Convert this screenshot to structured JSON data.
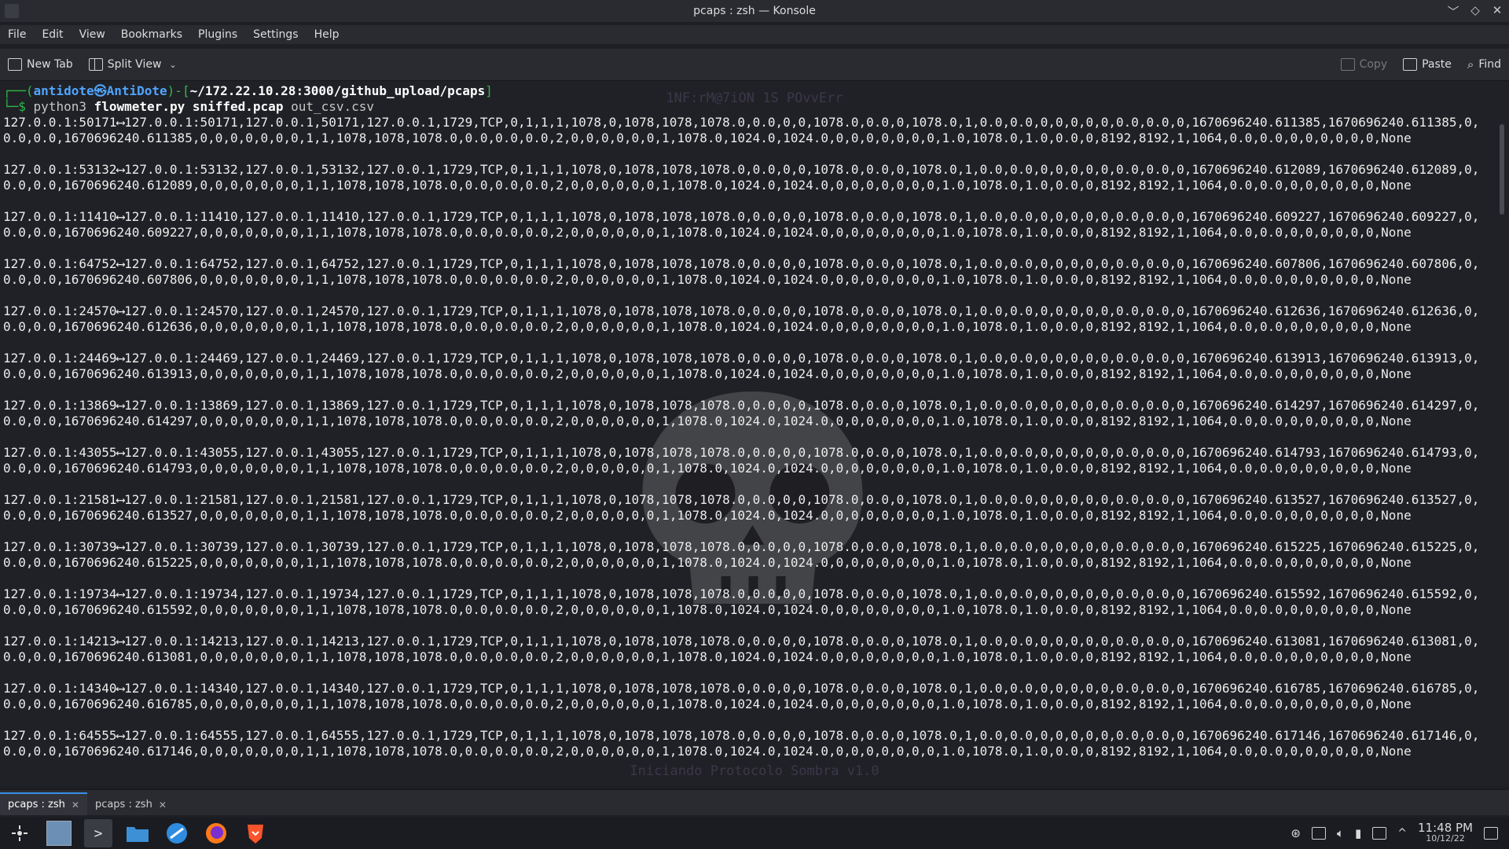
{
  "window": {
    "title": "pcaps : zsh — Konsole",
    "controls": [
      "﹀",
      "◇",
      "✕"
    ]
  },
  "menu": [
    "File",
    "Edit",
    "View",
    "Bookmarks",
    "Plugins",
    "Settings",
    "Help"
  ],
  "toolbar": {
    "new_tab": "New Tab",
    "split_view": "Split View",
    "copy": "Copy",
    "paste": "Paste",
    "find": "Find"
  },
  "terminal": {
    "prompt_line": "┌──(antidote㉿AntiDote)-[~/172.22.10.28:3000/github_upload/pcaps]",
    "prompt_user": "antidote㉿AntiDote",
    "prompt_path": "~/172.22.10.28:3000/github_upload/pcaps",
    "cmd_prefix": "└─$",
    "cmd_python": "python3",
    "cmd_script": "flowmeter.py sniffed.pcap",
    "cmd_out": "out_csv.csv",
    "rows": [
      [
        "127.0.0.1:50171⟷127.0.0.1:50171,127.0.0.1,50171,127.0.0.1,1729,TCP,0,1,1,1,1078,0,1078,1078,1078.0,0.0,0,0,1078.0,0.0,0,1078.0,1,0.0,0.0,0,0,0,0,0,0.0,0.0,0,1670696240.611385,1670696240.611385,0,",
        "0.0,0.0,1670696240.611385,0,0,0,0,0,0,0,1,1,1078,1078,1078.0,0.0,0.0,0.0,2,0,0,0,0,0,0,1,1078.0,1024.0,1024.0,0,0,0,0,0,0,0,1.0,1078.0,1.0,0.0,0,8192,8192,1,1064,0.0,0.0,0,0,0,0,0,0,None"
      ],
      [
        "127.0.0.1:53132⟷127.0.0.1:53132,127.0.0.1,53132,127.0.0.1,1729,TCP,0,1,1,1,1078,0,1078,1078,1078.0,0.0,0,0,1078.0,0.0,0,1078.0,1,0.0,0.0,0,0,0,0,0,0.0,0.0,0,1670696240.612089,1670696240.612089,0,",
        "0.0,0.0,1670696240.612089,0,0,0,0,0,0,0,1,1,1078,1078,1078.0,0.0,0.0,0.0,2,0,0,0,0,0,0,1,1078.0,1024.0,1024.0,0,0,0,0,0,0,0,1.0,1078.0,1.0,0.0,0,8192,8192,1,1064,0.0,0.0,0,0,0,0,0,0,None"
      ],
      [
        "127.0.0.1:11410⟷127.0.0.1:11410,127.0.0.1,11410,127.0.0.1,1729,TCP,0,1,1,1,1078,0,1078,1078,1078.0,0.0,0,0,1078.0,0.0,0,1078.0,1,0.0,0.0,0,0,0,0,0,0.0,0.0,0,1670696240.609227,1670696240.609227,0,",
        "0.0,0.0,1670696240.609227,0,0,0,0,0,0,0,1,1,1078,1078,1078.0,0.0,0.0,0.0,2,0,0,0,0,0,0,1,1078.0,1024.0,1024.0,0,0,0,0,0,0,0,1.0,1078.0,1.0,0.0,0,8192,8192,1,1064,0.0,0.0,0,0,0,0,0,0,None"
      ],
      [
        "127.0.0.1:64752⟷127.0.0.1:64752,127.0.0.1,64752,127.0.0.1,1729,TCP,0,1,1,1,1078,0,1078,1078,1078.0,0.0,0,0,1078.0,0.0,0,1078.0,1,0.0,0.0,0,0,0,0,0,0.0,0.0,0,1670696240.607806,1670696240.607806,0,",
        "0.0,0.0,1670696240.607806,0,0,0,0,0,0,0,1,1,1078,1078,1078.0,0.0,0.0,0.0,2,0,0,0,0,0,0,1,1078.0,1024.0,1024.0,0,0,0,0,0,0,0,1.0,1078.0,1.0,0.0,0,8192,8192,1,1064,0.0,0.0,0,0,0,0,0,0,None"
      ],
      [
        "127.0.0.1:24570⟷127.0.0.1:24570,127.0.0.1,24570,127.0.0.1,1729,TCP,0,1,1,1,1078,0,1078,1078,1078.0,0.0,0,0,1078.0,0.0,0,1078.0,1,0.0,0.0,0,0,0,0,0,0.0,0.0,0,1670696240.612636,1670696240.612636,0,",
        "0.0,0.0,1670696240.612636,0,0,0,0,0,0,0,1,1,1078,1078,1078.0,0.0,0.0,0.0,2,0,0,0,0,0,0,1,1078.0,1024.0,1024.0,0,0,0,0,0,0,0,1.0,1078.0,1.0,0.0,0,8192,8192,1,1064,0.0,0.0,0,0,0,0,0,0,None"
      ],
      [
        "127.0.0.1:24469⟷127.0.0.1:24469,127.0.0.1,24469,127.0.0.1,1729,TCP,0,1,1,1,1078,0,1078,1078,1078.0,0.0,0,0,1078.0,0.0,0,1078.0,1,0.0,0.0,0,0,0,0,0,0.0,0.0,0,1670696240.613913,1670696240.613913,0,",
        "0.0,0.0,1670696240.613913,0,0,0,0,0,0,0,1,1,1078,1078,1078.0,0.0,0.0,0.0,2,0,0,0,0,0,0,1,1078.0,1024.0,1024.0,0,0,0,0,0,0,0,1.0,1078.0,1.0,0.0,0,8192,8192,1,1064,0.0,0.0,0,0,0,0,0,0,None"
      ],
      [
        "127.0.0.1:13869⟷127.0.0.1:13869,127.0.0.1,13869,127.0.0.1,1729,TCP,0,1,1,1,1078,0,1078,1078,1078.0,0.0,0,0,1078.0,0.0,0,1078.0,1,0.0,0.0,0,0,0,0,0,0.0,0.0,0,1670696240.614297,1670696240.614297,0,",
        "0.0,0.0,1670696240.614297,0,0,0,0,0,0,0,1,1,1078,1078,1078.0,0.0,0.0,0.0,2,0,0,0,0,0,0,1,1078.0,1024.0,1024.0,0,0,0,0,0,0,0,1.0,1078.0,1.0,0.0,0,8192,8192,1,1064,0.0,0.0,0,0,0,0,0,0,None"
      ],
      [
        "127.0.0.1:43055⟷127.0.0.1:43055,127.0.0.1,43055,127.0.0.1,1729,TCP,0,1,1,1,1078,0,1078,1078,1078.0,0.0,0,0,1078.0,0.0,0,1078.0,1,0.0,0.0,0,0,0,0,0,0.0,0.0,0,1670696240.614793,1670696240.614793,0,",
        "0.0,0.0,1670696240.614793,0,0,0,0,0,0,0,1,1,1078,1078,1078.0,0.0,0.0,0.0,2,0,0,0,0,0,0,1,1078.0,1024.0,1024.0,0,0,0,0,0,0,0,1.0,1078.0,1.0,0.0,0,8192,8192,1,1064,0.0,0.0,0,0,0,0,0,0,None"
      ],
      [
        "127.0.0.1:21581⟷127.0.0.1:21581,127.0.0.1,21581,127.0.0.1,1729,TCP,0,1,1,1,1078,0,1078,1078,1078.0,0.0,0,0,1078.0,0.0,0,1078.0,1,0.0,0.0,0,0,0,0,0,0.0,0.0,0,1670696240.613527,1670696240.613527,0,",
        "0.0,0.0,1670696240.613527,0,0,0,0,0,0,0,1,1,1078,1078,1078.0,0.0,0.0,0.0,2,0,0,0,0,0,0,1,1078.0,1024.0,1024.0,0,0,0,0,0,0,0,1.0,1078.0,1.0,0.0,0,8192,8192,1,1064,0.0,0.0,0,0,0,0,0,0,None"
      ],
      [
        "127.0.0.1:30739⟷127.0.0.1:30739,127.0.0.1,30739,127.0.0.1,1729,TCP,0,1,1,1,1078,0,1078,1078,1078.0,0.0,0,0,1078.0,0.0,0,1078.0,1,0.0,0.0,0,0,0,0,0,0.0,0.0,0,1670696240.615225,1670696240.615225,0,",
        "0.0,0.0,1670696240.615225,0,0,0,0,0,0,0,1,1,1078,1078,1078.0,0.0,0.0,0.0,2,0,0,0,0,0,0,1,1078.0,1024.0,1024.0,0,0,0,0,0,0,0,1.0,1078.0,1.0,0.0,0,8192,8192,1,1064,0.0,0.0,0,0,0,0,0,0,None"
      ],
      [
        "127.0.0.1:19734⟷127.0.0.1:19734,127.0.0.1,19734,127.0.0.1,1729,TCP,0,1,1,1,1078,0,1078,1078,1078.0,0.0,0,0,1078.0,0.0,0,1078.0,1,0.0,0.0,0,0,0,0,0,0.0,0.0,0,1670696240.615592,1670696240.615592,0,",
        "0.0,0.0,1670696240.615592,0,0,0,0,0,0,0,1,1,1078,1078,1078.0,0.0,0.0,0.0,2,0,0,0,0,0,0,1,1078.0,1024.0,1024.0,0,0,0,0,0,0,0,1.0,1078.0,1.0,0.0,0,8192,8192,1,1064,0.0,0.0,0,0,0,0,0,0,None"
      ],
      [
        "127.0.0.1:14213⟷127.0.0.1:14213,127.0.0.1,14213,127.0.0.1,1729,TCP,0,1,1,1,1078,0,1078,1078,1078.0,0.0,0,0,1078.0,0.0,0,1078.0,1,0.0,0.0,0,0,0,0,0,0.0,0.0,0,1670696240.613081,1670696240.613081,0,",
        "0.0,0.0,1670696240.613081,0,0,0,0,0,0,0,1,1,1078,1078,1078.0,0.0,0.0,0.0,2,0,0,0,0,0,0,1,1078.0,1024.0,1024.0,0,0,0,0,0,0,0,1.0,1078.0,1.0,0.0,0,8192,8192,1,1064,0.0,0.0,0,0,0,0,0,0,None"
      ],
      [
        "127.0.0.1:14340⟷127.0.0.1:14340,127.0.0.1,14340,127.0.0.1,1729,TCP,0,1,1,1,1078,0,1078,1078,1078.0,0.0,0,0,1078.0,0.0,0,1078.0,1,0.0,0.0,0,0,0,0,0,0.0,0.0,0,1670696240.616785,1670696240.616785,0,",
        "0.0,0.0,1670696240.616785,0,0,0,0,0,0,0,1,1,1078,1078,1078.0,0.0,0.0,0.0,2,0,0,0,0,0,0,1,1078.0,1024.0,1024.0,0,0,0,0,0,0,0,1.0,1078.0,1.0,0.0,0,8192,8192,1,1064,0.0,0.0,0,0,0,0,0,0,None"
      ],
      [
        "127.0.0.1:64555⟷127.0.0.1:64555,127.0.0.1,64555,127.0.0.1,1729,TCP,0,1,1,1,1078,0,1078,1078,1078.0,0.0,0,0,1078.0,0.0,0,1078.0,1,0.0,0.0,0,0,0,0,0,0.0,0.0,0,1670696240.617146,1670696240.617146,0,",
        "0.0,0.0,1670696240.617146,0,0,0,0,0,0,0,1,1,1078,1078,1078.0,0.0,0.0,0.0,2,0,0,0,0,0,0,1,1078.0,1024.0,1024.0,0,0,0,0,0,0,0,1.0,1078.0,1.0,0.0,0,8192,8192,1,1064,0.0,0.0,0,0,0,0,0,0,None"
      ]
    ],
    "background_text": {
      "top": "1NF:rM@7iON 1S POvvErr",
      "bottom": "Iniciando Protocolo Sombra v1.0"
    }
  },
  "tabs": [
    {
      "label": "pcaps : zsh",
      "close": "✕"
    },
    {
      "label": "pcaps : zsh",
      "close": "✕"
    }
  ],
  "taskbar": {
    "apps": [
      "app-launcher-icon",
      "desktop-pager-icon",
      "konsole-icon",
      "file-manager-icon",
      "discover-icon",
      "firefox-icon",
      "brave-icon"
    ],
    "clock_time": "11:48 PM",
    "clock_date": "10/12/22"
  },
  "colors": {
    "prompt_green": "#2fb84a",
    "prompt_user": "#4fa5ff",
    "accent": "#3a8ee6"
  }
}
